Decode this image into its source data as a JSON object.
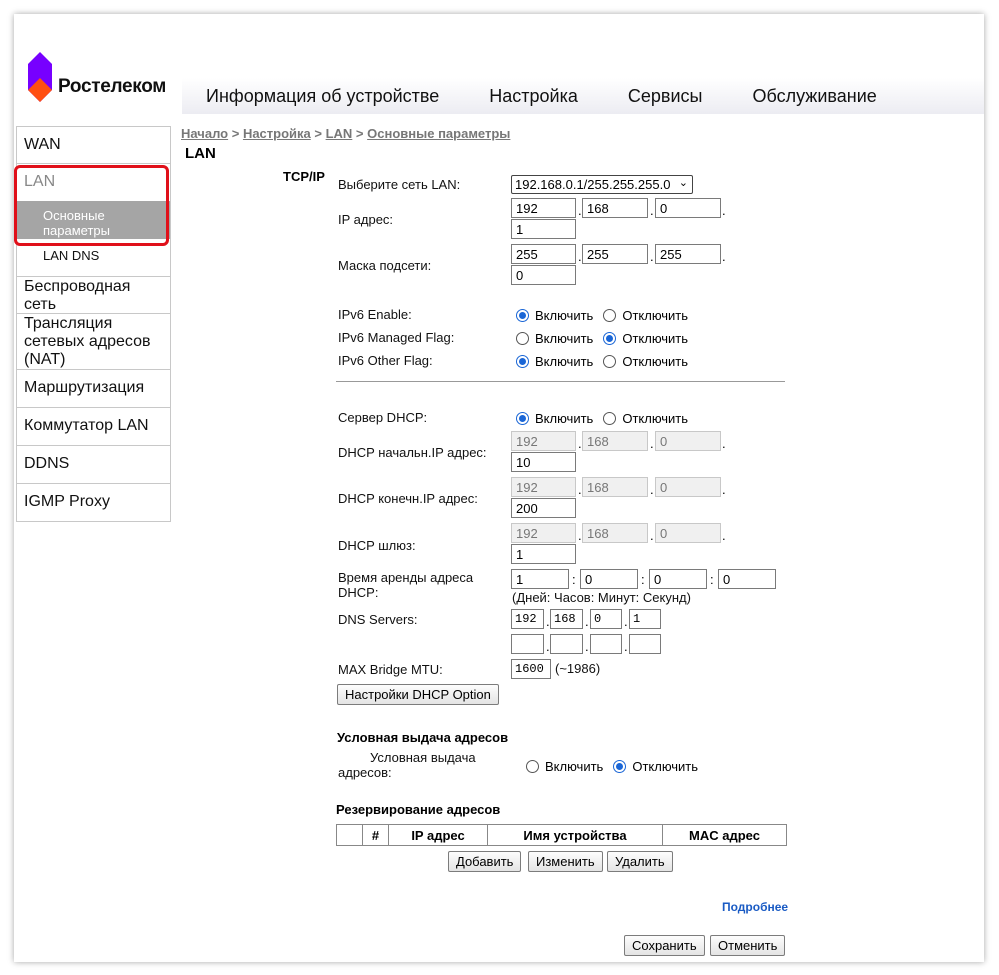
{
  "brand": {
    "name": "Ростелеком",
    "mark_color": "#7700ff",
    "accent_color": "#ff4f12"
  },
  "topnav": [
    "Информация об устройстве",
    "Настройка",
    "Сервисы",
    "Обслуживание"
  ],
  "sidebar": {
    "items": [
      "WAN",
      "LAN",
      "Беспроводная сеть",
      "Трансляция сетевых адресов (NAT)",
      "Маршрутизация",
      "Коммутатор LAN",
      "DDNS",
      "IGMP Proxy"
    ],
    "lan_sub": [
      "Основные параметры",
      "LAN DNS"
    ]
  },
  "breadcrumb": {
    "items": [
      "Начало",
      "Настройка",
      "LAN",
      "Основные параметры"
    ],
    "sep": " > "
  },
  "page_title": "LAN",
  "section": "TCP/IP",
  "lan": {
    "select_label": "Выберите сеть LAN:",
    "select_value": "192.168.0.1/255.255.255.0",
    "ip_label": "IP адрес:",
    "ip": [
      "192",
      "168",
      "0",
      "1"
    ],
    "mask_label": "Маска подсети:",
    "mask": [
      "255",
      "255",
      "255",
      "0"
    ]
  },
  "ipv6": {
    "enable_label": "IPv6 Enable:",
    "managed_label": "IPv6 Managed Flag:",
    "other_label": "IPv6 Other Flag:",
    "on": "Включить",
    "off": "Отключить"
  },
  "dhcp": {
    "server_label": "Сервер DHCP:",
    "start_label": "DHCP начальн.IP адрес:",
    "start": [
      "192",
      "168",
      "0",
      "10"
    ],
    "end_label": "DHCP конечн.IP адрес:",
    "end": [
      "192",
      "168",
      "0",
      "200"
    ],
    "gw_label": "DHCP шлюз:",
    "gw": [
      "192",
      "168",
      "0",
      "1"
    ],
    "lease_label": "Время аренды адреса DHCP:",
    "lease": [
      "1",
      "0",
      "0",
      "0"
    ],
    "lease_hint": "(Дней: Часов: Минут: Секунд)",
    "dns_label": "DNS Servers:",
    "dns1": [
      "192",
      "168",
      "0",
      "1"
    ],
    "dns2": [
      "",
      "",
      "",
      ""
    ],
    "mtu_label": "MAX Bridge MTU:",
    "mtu": "1600",
    "mtu_hint": "(~1986)",
    "option_button": "Настройки DHCP Option"
  },
  "conditional": {
    "heading": "Условная выдача адресов",
    "label": "Условная выдача адресов:"
  },
  "reservation": {
    "heading": "Резервирование адресов",
    "columns": [
      "",
      "#",
      "IP адрес",
      "Имя устройства",
      "MAC адрес"
    ],
    "add": "Добавить",
    "edit": "Изменить",
    "delete": "Удалить"
  },
  "more_link": "Подробнее",
  "save": "Сохранить",
  "cancel": "Отменить"
}
